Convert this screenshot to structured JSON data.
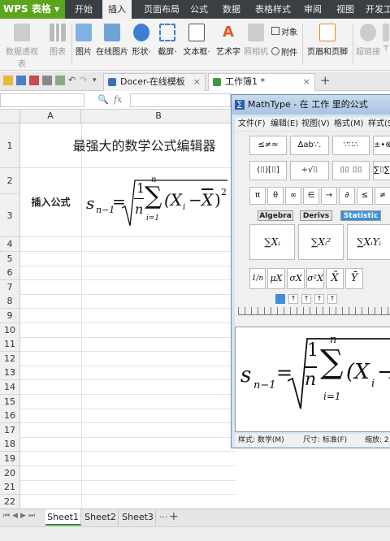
{
  "app": {
    "name": "WPS 表格",
    "dropdown": "▾"
  },
  "menu_tabs": [
    "开始",
    "插入",
    "页面布局",
    "公式",
    "数据",
    "表格样式",
    "审阅",
    "视图",
    "开发工"
  ],
  "active_menu": "插入",
  "ribbon": {
    "items": [
      {
        "label": "数据透视表",
        "enabled": false
      },
      {
        "label": "图表",
        "enabled": false
      },
      {
        "label": "图片",
        "enabled": true
      },
      {
        "label": "在线图片",
        "enabled": true
      },
      {
        "label": "形状·",
        "enabled": true
      },
      {
        "label": "截屏·",
        "enabled": true
      },
      {
        "label": "文本框·",
        "enabled": true
      },
      {
        "label": "艺术字",
        "enabled": true
      },
      {
        "label": "照相机",
        "enabled": false
      },
      {
        "label": "对象",
        "enabled": true
      },
      {
        "label": "附件",
        "enabled": true
      },
      {
        "label": "页眉和页脚",
        "enabled": true
      },
      {
        "label": "超链接",
        "enabled": false
      },
      {
        "label": "T",
        "enabled": false
      }
    ]
  },
  "doc_tabs": [
    {
      "label": "Docer-在线模板",
      "close": "×"
    },
    {
      "label": "工作簿1 *",
      "close": "×"
    }
  ],
  "new_tab": "+",
  "formula_bar": {
    "zoom_icon": "🔍",
    "fx": "fx",
    "value": ""
  },
  "columns": [
    "A",
    "B"
  ],
  "rows": [
    "1",
    "2",
    "3",
    "4",
    "5",
    "6",
    "7",
    "8",
    "9",
    "10",
    "11",
    "12",
    "13",
    "14",
    "15",
    "16",
    "17",
    "18",
    "19",
    "20",
    "21",
    "22"
  ],
  "cells": {
    "title": "最强大的数学公式编辑器",
    "label": "插入公式"
  },
  "formula": {
    "lhs": "s",
    "lhs_sub": "n−1",
    "eq": "=",
    "frac_num": "1",
    "frac_den": "n",
    "sum_top": "n",
    "sum_bot": "i=1",
    "body": "(X",
    "body_sub": "i",
    "minus": "−",
    "xbar": "X",
    "close": ")",
    "power": "2"
  },
  "sheet_tabs": [
    "Sheet1",
    "Sheet2",
    "Sheet3"
  ],
  "sheet_more": "···",
  "sheet_add": "+",
  "mathtype": {
    "title": "MathType - 在 工作 里的公式",
    "menu": [
      "文件(F)",
      "编辑(E)",
      "视图(V)",
      "格式(M)",
      "样式(S)"
    ],
    "palette_rows": [
      [
        "≤≠≈",
        "∆ab∵.",
        "∵∷∴",
        "±•⊗"
      ],
      [
        "(⌷)[⌷]",
        "÷√⌷",
        "⌷⌷ ⌷⌷",
        "∑⌷∑⌷"
      ],
      [
        "π",
        "θ",
        "∞",
        "∈",
        "→",
        "∂",
        "≤",
        "≠"
      ]
    ],
    "tabs": [
      "Algebra",
      "Derivs",
      "Statistic"
    ],
    "active_tab": "Statistic",
    "stat_row1": [
      "∑Xᵢ",
      "∑Xᵢ²",
      "∑XᵢYᵢ"
    ],
    "stat_row2": [
      "1/n",
      "μX",
      "σX",
      "σ²X",
      "X̄",
      "Ȳ"
    ],
    "status": {
      "style": "样式: 数学(M)",
      "size": "尺寸: 标准(F)",
      "zoom": "缩放: 2"
    }
  }
}
